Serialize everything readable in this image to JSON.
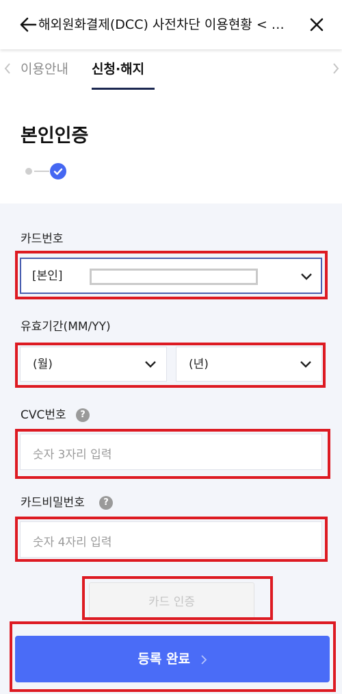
{
  "header": {
    "title": "해외원화결제(DCC) 사전차단 이용현황 < …",
    "back_icon": "arrow-left-icon",
    "close_icon": "close-icon"
  },
  "tabs": {
    "items": [
      {
        "label": "이용안내",
        "active": false
      },
      {
        "label": "신청·해지",
        "active": true
      }
    ]
  },
  "section": {
    "title": "본인인증",
    "steps": {
      "total": 2,
      "current": 2
    }
  },
  "form": {
    "card_number": {
      "label": "카드번호",
      "value_prefix": "[본인]"
    },
    "expiry": {
      "label": "유효기간(MM/YY)",
      "month_value": "(월)",
      "year_value": "(년)"
    },
    "cvc": {
      "label": "CVC번호",
      "help": "?",
      "placeholder": "숫자 3자리 입력"
    },
    "card_password": {
      "label": "카드비밀번호",
      "help": "?",
      "placeholder": "숫자 4자리 입력"
    },
    "verify_button": "카드 인증",
    "submit_button": "등록 완료"
  },
  "colors": {
    "accent": "#4a6cf7",
    "highlight": "#dd1a22",
    "tab_underline": "#1b2750",
    "form_background": "#f3f5fa"
  }
}
